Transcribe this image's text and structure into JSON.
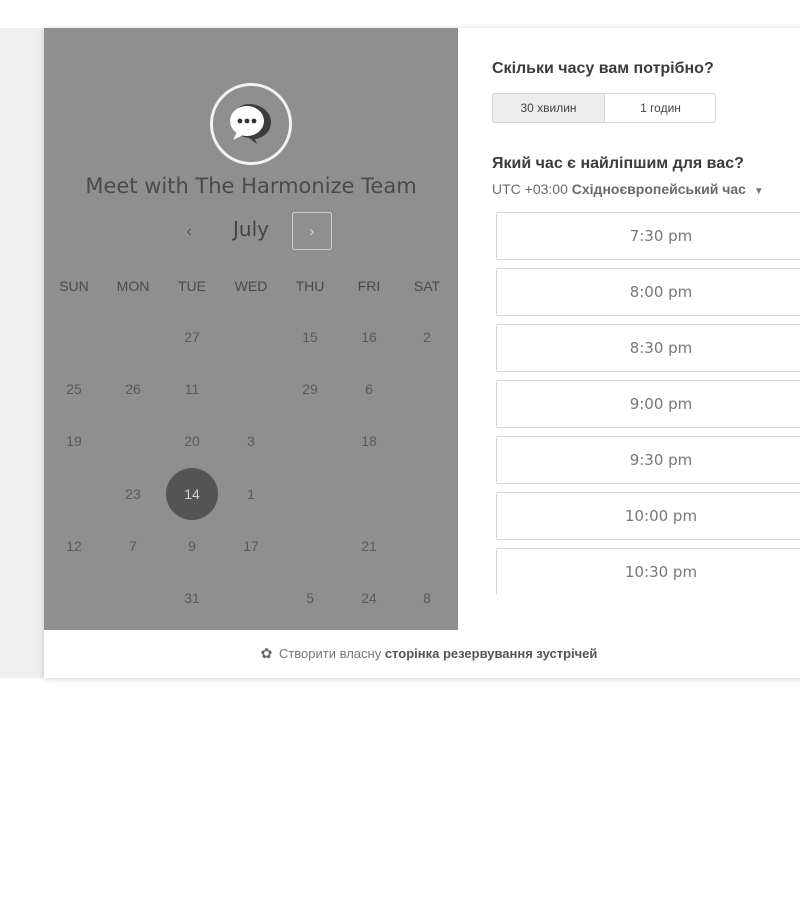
{
  "meeting": {
    "title": "Meet with The Harmonize Team"
  },
  "calendar": {
    "month": "July",
    "prev_icon": "chevron-left-icon",
    "next_icon": "chevron-right-icon",
    "weekdays": [
      "SUN",
      "MON",
      "TUE",
      "WED",
      "THU",
      "FRI",
      "SAT"
    ],
    "rows": [
      [
        "",
        "",
        "27",
        "",
        "15",
        "16",
        "2"
      ],
      [
        "25",
        "26",
        "11",
        "",
        "29",
        "6",
        ""
      ],
      [
        "19",
        "",
        "20",
        "3",
        "",
        "18",
        ""
      ],
      [
        "",
        "23",
        "14",
        "1",
        "",
        "",
        ""
      ],
      [
        "12",
        "7",
        "9",
        "17",
        "",
        "21",
        ""
      ],
      [
        "",
        "",
        "31",
        "",
        "5",
        "24",
        "8"
      ]
    ],
    "selected_day": "14"
  },
  "duration": {
    "question": "Скільки часу вам потрібно?",
    "options": [
      "30 хвилин",
      "1 годин"
    ],
    "selected": "30 хвилин"
  },
  "time": {
    "question": "Який час є найліпшим для вас?",
    "timezone_offset": "UTC +03:00",
    "timezone_name": "Східноєвропейський час",
    "slots": [
      "7:30 pm",
      "8:00 pm",
      "8:30 pm",
      "9:00 pm",
      "9:30 pm",
      "10:00 pm",
      "10:30 pm"
    ]
  },
  "footer": {
    "icon": "hubspot-sprocket-icon",
    "text_prefix": "Створити власну",
    "text_bold": "сторінка резервування зустрічей"
  },
  "colors": {
    "left_panel": "#8f8f8f",
    "selected_day": "#555555",
    "background": "#efefef"
  }
}
